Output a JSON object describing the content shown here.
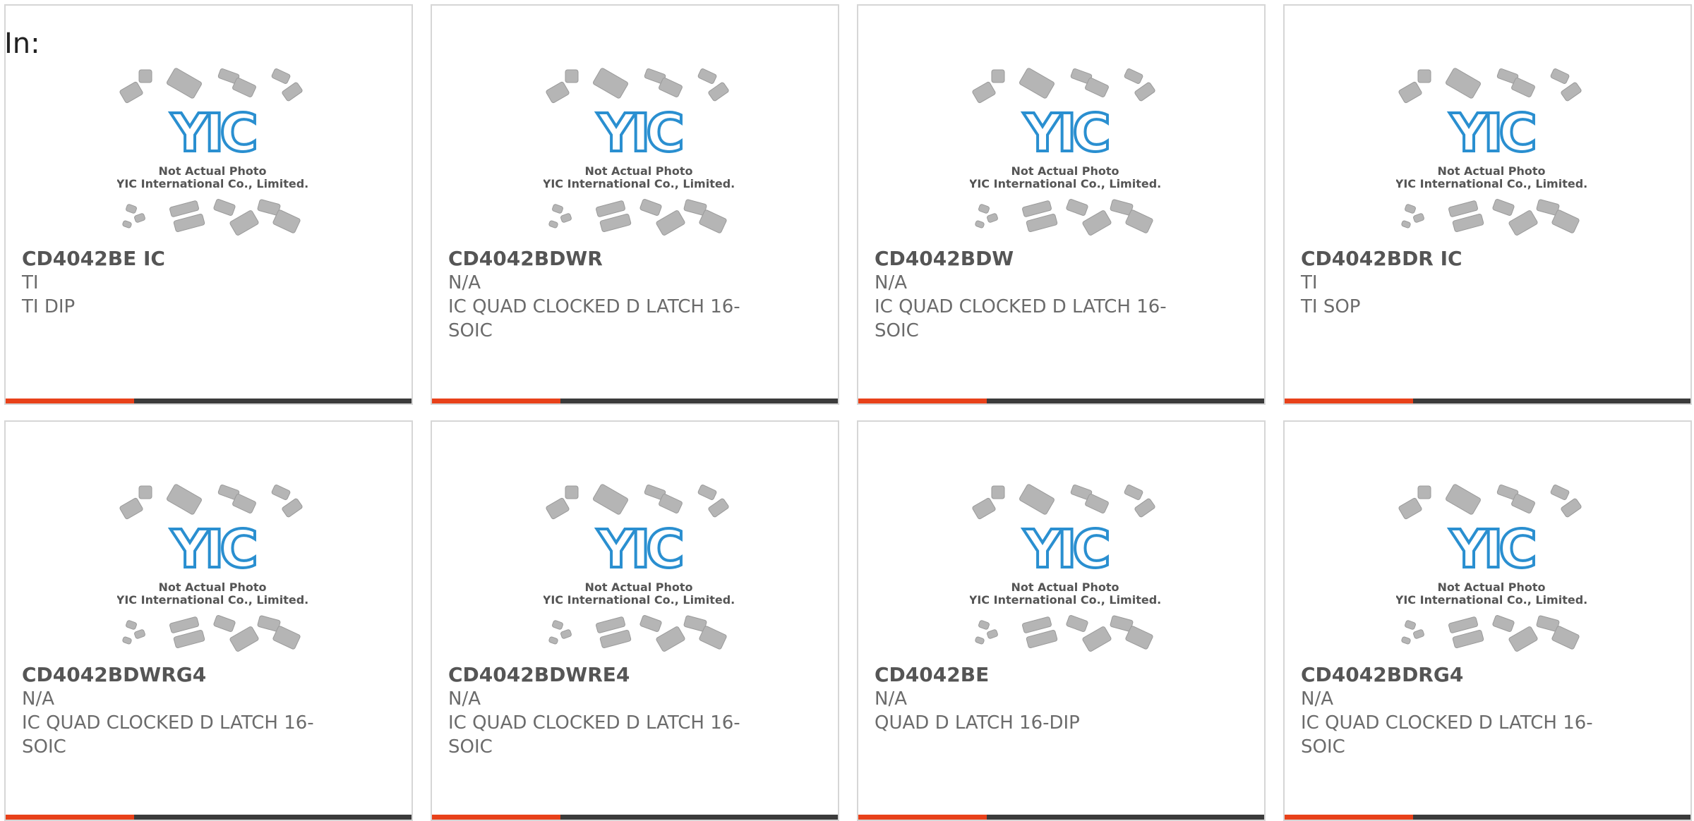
{
  "page": {
    "prefix_label": "In:"
  },
  "placeholder_image": {
    "caption_line1": "Not Actual Photo",
    "caption_line2": "YIC International Co., Limited.",
    "logo_text": "YIC"
  },
  "colors": {
    "accent": "#e8411a",
    "bar_dark": "#3b3b3b",
    "logo_blue": "#2a8fd0",
    "chip_gray": "#b5b5b5"
  },
  "products": [
    {
      "part_number": "CD4042BE IC",
      "manufacturer": "TI",
      "description": "TI DIP"
    },
    {
      "part_number": "CD4042BDWR",
      "manufacturer": "N/A",
      "description": "IC QUAD CLOCKED D LATCH 16-SOIC"
    },
    {
      "part_number": "CD4042BDW",
      "manufacturer": "N/A",
      "description": "IC QUAD CLOCKED D LATCH 16-SOIC"
    },
    {
      "part_number": "CD4042BDR IC",
      "manufacturer": "TI",
      "description": "TI SOP"
    },
    {
      "part_number": "CD4042BDWRG4",
      "manufacturer": "N/A",
      "description": "IC QUAD CLOCKED D LATCH 16-SOIC"
    },
    {
      "part_number": "CD4042BDWRE4",
      "manufacturer": "N/A",
      "description": "IC QUAD CLOCKED D LATCH 16-SOIC"
    },
    {
      "part_number": "CD4042BE",
      "manufacturer": "N/A",
      "description": "QUAD D LATCH 16-DIP"
    },
    {
      "part_number": "CD4042BDRG4",
      "manufacturer": "N/A",
      "description": "IC QUAD CLOCKED D LATCH 16-SOIC"
    }
  ]
}
